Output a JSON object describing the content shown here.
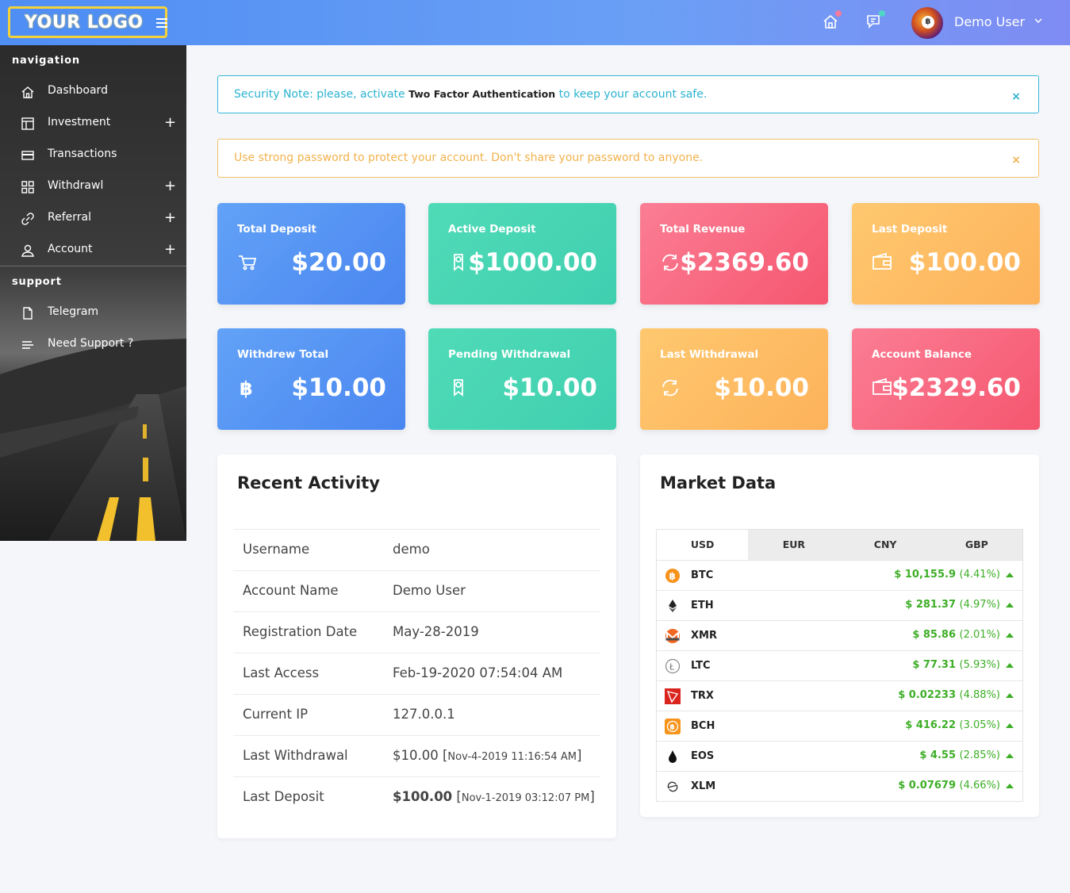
{
  "header": {
    "logo_text": "YOUR LOGO",
    "user_name": "Demo User"
  },
  "sidebar": {
    "sections": [
      {
        "title": "navigation"
      },
      {
        "title": "support"
      }
    ],
    "items": [
      {
        "label": "Dashboard",
        "icon": "home-icon",
        "expandable": false
      },
      {
        "label": "Investment",
        "icon": "layout-icon",
        "expandable": true
      },
      {
        "label": "Transactions",
        "icon": "card-icon",
        "expandable": false
      },
      {
        "label": "Withdrawl",
        "icon": "grid-icon",
        "expandable": true
      },
      {
        "label": "Referral",
        "icon": "link-icon",
        "expandable": true
      },
      {
        "label": "Account",
        "icon": "user-icon",
        "expandable": true
      },
      {
        "label": "Telegram",
        "icon": "file-icon",
        "expandable": false
      },
      {
        "label": "Need Support ?",
        "icon": "menu-lines-icon",
        "expandable": false
      }
    ],
    "expand_symbol": "+"
  },
  "alerts": {
    "security": {
      "prefix": "Security Note: please, activate ",
      "strong": "Two Factor Authentication",
      "suffix": " to keep your account safe.",
      "close": "×"
    },
    "password": {
      "text": "Use strong password to protect your account. Don't share your password to anyone.",
      "close": "×"
    }
  },
  "stats": [
    {
      "title": "Total Deposit",
      "value": "$20.00",
      "icon": "cart-icon",
      "color": "blue"
    },
    {
      "title": "Active Deposit",
      "value": "$1000.00",
      "icon": "ribbon-icon",
      "color": "green"
    },
    {
      "title": "Total Revenue",
      "value": "$2369.60",
      "icon": "refresh-icon",
      "color": "red"
    },
    {
      "title": "Last Deposit",
      "value": "$100.00",
      "icon": "wallet-icon",
      "color": "orange"
    },
    {
      "title": "Withdrew Total",
      "value": "$10.00",
      "icon": "bitcoin-icon",
      "color": "blue"
    },
    {
      "title": "Pending Withdrawal",
      "value": "$10.00",
      "icon": "ribbon-icon",
      "color": "green"
    },
    {
      "title": "Last Withdrawal",
      "value": "$10.00",
      "icon": "refresh-icon",
      "color": "orange"
    },
    {
      "title": "Account Balance",
      "value": "$2329.60",
      "icon": "wallet-icon",
      "color": "red"
    }
  ],
  "activity": {
    "title": "Recent Activity",
    "rows": [
      {
        "key": "Username",
        "value": "demo"
      },
      {
        "key": "Account Name",
        "value": "Demo User"
      },
      {
        "key": "Registration Date",
        "value": "May-28-2019"
      },
      {
        "key": "Last Access",
        "value": "Feb-19-2020 07:54:04 AM"
      },
      {
        "key": "Current IP",
        "value": "127.0.0.1"
      },
      {
        "key": "Last Withdrawal",
        "value": "$10.00",
        "detail": "Nov-4-2019 11:16:54 AM"
      },
      {
        "key": "Last Deposit",
        "value": "$100.00",
        "detail": "Nov-1-2019 03:12:07 PM"
      }
    ]
  },
  "market": {
    "title": "Market Data",
    "tabs": [
      "USD",
      "EUR",
      "CNY",
      "GBP"
    ],
    "active_tab": "USD",
    "coins": [
      {
        "symbol": "BTC",
        "price": "$ 10,155.9",
        "change": "(4.41%)",
        "icon": "btc-icon",
        "trend": "up"
      },
      {
        "symbol": "ETH",
        "price": "$ 281.37",
        "change": "(4.97%)",
        "icon": "eth-icon",
        "trend": "up"
      },
      {
        "symbol": "XMR",
        "price": "$ 85.86",
        "change": "(2.01%)",
        "icon": "xmr-icon",
        "trend": "up"
      },
      {
        "symbol": "LTC",
        "price": "$ 77.31",
        "change": "(5.93%)",
        "icon": "ltc-icon",
        "trend": "up"
      },
      {
        "symbol": "TRX",
        "price": "$ 0.02233",
        "change": "(4.88%)",
        "icon": "trx-icon",
        "trend": "up"
      },
      {
        "symbol": "BCH",
        "price": "$ 416.22",
        "change": "(3.05%)",
        "icon": "bch-icon",
        "trend": "up"
      },
      {
        "symbol": "EOS",
        "price": "$ 4.55",
        "change": "(2.85%)",
        "icon": "eos-icon",
        "trend": "up"
      },
      {
        "symbol": "XLM",
        "price": "$ 0.07679",
        "change": "(4.66%)",
        "icon": "xlm-icon",
        "trend": "up"
      }
    ],
    "price_color": "#3eae27"
  },
  "colors": {
    "header_blue": "#4f8ef4",
    "info": "#2bb3cf",
    "warning": "#f2b24d",
    "card_blue": "#4a86f0",
    "card_green": "#3fcfb0",
    "card_red": "#f5566f",
    "card_orange": "#fdb25a"
  }
}
